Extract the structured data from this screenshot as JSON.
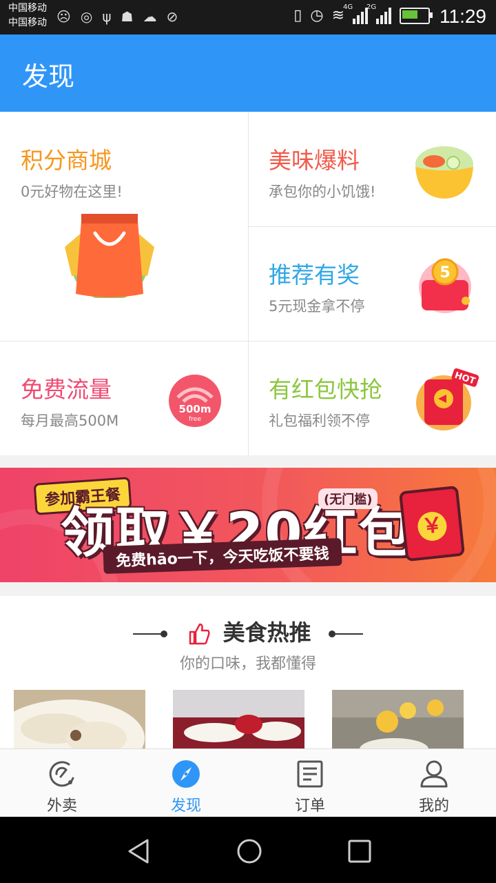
{
  "status_bar": {
    "carriers": [
      "中国移动",
      "中国移动"
    ],
    "net1": "4G",
    "net2": "2G",
    "time": "11:29",
    "battery_level": 0.6
  },
  "header": {
    "title": "发现"
  },
  "grid": [
    {
      "title": "积分商城",
      "subtitle": "0元好物在这里!",
      "color": "#f6961e",
      "icon": "shopping-bag-icon"
    },
    {
      "title": "美味爆料",
      "subtitle": "承包你的小饥饿!",
      "color": "#f05a4a",
      "icon": "food-bowl-icon"
    },
    {
      "title": "推荐有奖",
      "subtitle": "5元现金拿不停",
      "color": "#2fa7e6",
      "icon": "gift-coin-icon"
    },
    {
      "title": "免费流量",
      "subtitle": "每月最高500M",
      "color": "#ef4b72",
      "icon": "wifi-data-icon",
      "badge_main": "500m",
      "badge_sub": "free"
    },
    {
      "title": "有红包快抢",
      "subtitle": "礼包福利领不停",
      "color": "#8cc63f",
      "icon": "red-packet-icon",
      "badge": "HOT"
    }
  ],
  "banner": {
    "top_text": "参加霸王餐",
    "main_text": "领取￥20红包",
    "tag": "(无门槛)",
    "sub_text": "免费hāo一下，今天吃饭不要钱",
    "coin_symbol": "￥"
  },
  "food": {
    "title": "美食热推",
    "subtitle": "你的口味，我都懂得"
  },
  "bottom_nav": [
    {
      "label": "外卖",
      "icon": "takeout-icon",
      "active": false
    },
    {
      "label": "发现",
      "icon": "compass-icon",
      "active": true
    },
    {
      "label": "订单",
      "icon": "order-list-icon",
      "active": false
    },
    {
      "label": "我的",
      "icon": "user-icon",
      "active": false
    }
  ]
}
